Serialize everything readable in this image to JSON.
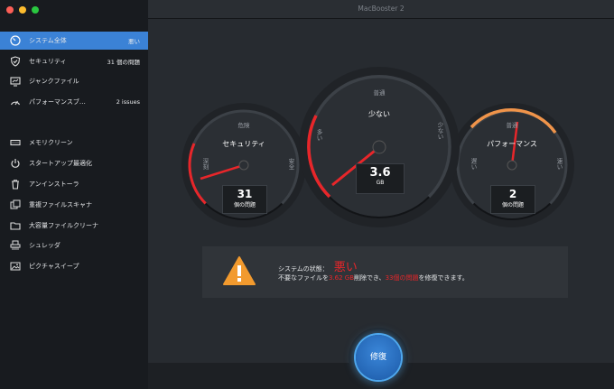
{
  "window": {
    "title": "MacBooster 2"
  },
  "sidebar": {
    "items": [
      {
        "label": "システム全体",
        "badge": "悪い",
        "icon": "system-icon",
        "active": true
      },
      {
        "label": "セキュリティ",
        "badge": "31 個の問題",
        "icon": "shield-icon"
      },
      {
        "label": "ジャンクファイル",
        "badge": "",
        "icon": "monitor-icon"
      },
      {
        "label": "パフォーマンスブ…",
        "badge": "2 issues",
        "icon": "speedometer-icon"
      },
      {
        "label": "メモリクリーン",
        "badge": "",
        "icon": "memory-icon"
      },
      {
        "label": "スタートアップ最適化",
        "badge": "",
        "icon": "power-icon"
      },
      {
        "label": "アンインストーラ",
        "badge": "",
        "icon": "trash-icon"
      },
      {
        "label": "重複ファイルスキャナ",
        "badge": "",
        "icon": "duplicate-icon"
      },
      {
        "label": "大容量ファイルクリーナ",
        "badge": "",
        "icon": "large-files-icon"
      },
      {
        "label": "シュレッダ",
        "badge": "",
        "icon": "shredder-icon"
      },
      {
        "label": "ピクチャスイープ",
        "badge": "",
        "icon": "picture-icon"
      }
    ]
  },
  "gauges": {
    "security": {
      "title": "セキュリティ",
      "top": "危険",
      "left": "深刻",
      "right": "安全",
      "value": "31",
      "unit": "個の問題",
      "color": "#e8262a",
      "level": 0.15
    },
    "junk": {
      "title": "少ない",
      "top": "普通",
      "left": "多い",
      "right": "少ない",
      "value": "3.6",
      "unit": "GB",
      "color": "#e8262a",
      "level": 0.2
    },
    "performance": {
      "title": "パフォーマンス",
      "top": "普通",
      "left": "遅い",
      "right": "速い",
      "value": "2",
      "unit": "個の問題",
      "color": "#f0944a",
      "level": 0.55
    }
  },
  "status": {
    "label": "システムの状態：",
    "state": "悪い",
    "msg_pre": "不要なファイルを",
    "size": "3.62 GB",
    "msg_mid": "削除でき、",
    "issues": "33個の問題",
    "msg_post": "を修復できます。"
  },
  "fix_button": {
    "label": "修復"
  },
  "colors": {
    "accent": "#3b82d6",
    "danger": "#e8262a",
    "warning": "#f0944a"
  }
}
